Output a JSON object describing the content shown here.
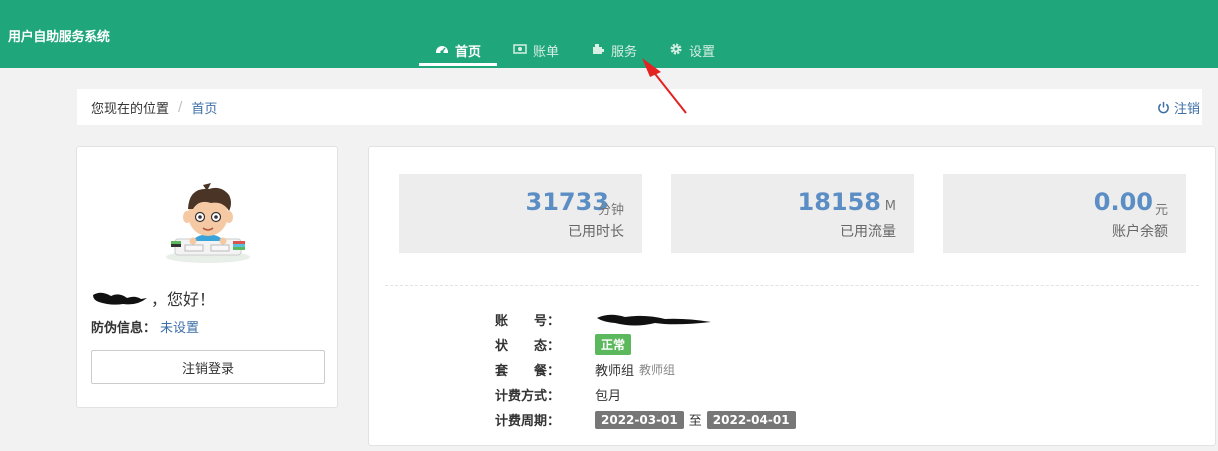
{
  "app": {
    "title": "用户自助服务系统"
  },
  "nav": {
    "items": [
      {
        "label": "首页",
        "icon": "dashboard-icon",
        "active": true
      },
      {
        "label": "账单",
        "icon": "money-icon",
        "active": false
      },
      {
        "label": "服务",
        "icon": "puzzle-icon",
        "active": false
      },
      {
        "label": "设置",
        "icon": "gear-icon",
        "active": false
      }
    ]
  },
  "breadcrumb": {
    "label": "您现在的位置",
    "separator": "/",
    "current": "首页",
    "logout": "注销"
  },
  "profile": {
    "greeting": "，您好！",
    "anti_label": "防伪信息：",
    "anti_value": "未设置",
    "logout_button": "注销登录"
  },
  "stats": [
    {
      "value": "31733",
      "unit": "分钟",
      "label": "已用时长"
    },
    {
      "value": "18158",
      "unit": "M",
      "label": "已用流量"
    },
    {
      "value": "0.00",
      "unit": "元",
      "label": "账户余额"
    }
  ],
  "account": {
    "account_label": "账　　号：",
    "status_label": "状　　态：",
    "status_value": "正常",
    "plan_label": "套　　餐：",
    "plan_value": "教师组",
    "plan_sub": "教师组",
    "billing_label": "计费方式：",
    "billing_value": "包月",
    "period_label": "计费周期：",
    "period_start": "2022-03-01",
    "period_sep": "至",
    "period_end": "2022-04-01"
  },
  "colors": {
    "header": "#1fa67a",
    "link": "#3b6ea5",
    "stat_value": "#5b8ec4",
    "status_ok": "#5cb85c",
    "date_badge": "#777777"
  }
}
